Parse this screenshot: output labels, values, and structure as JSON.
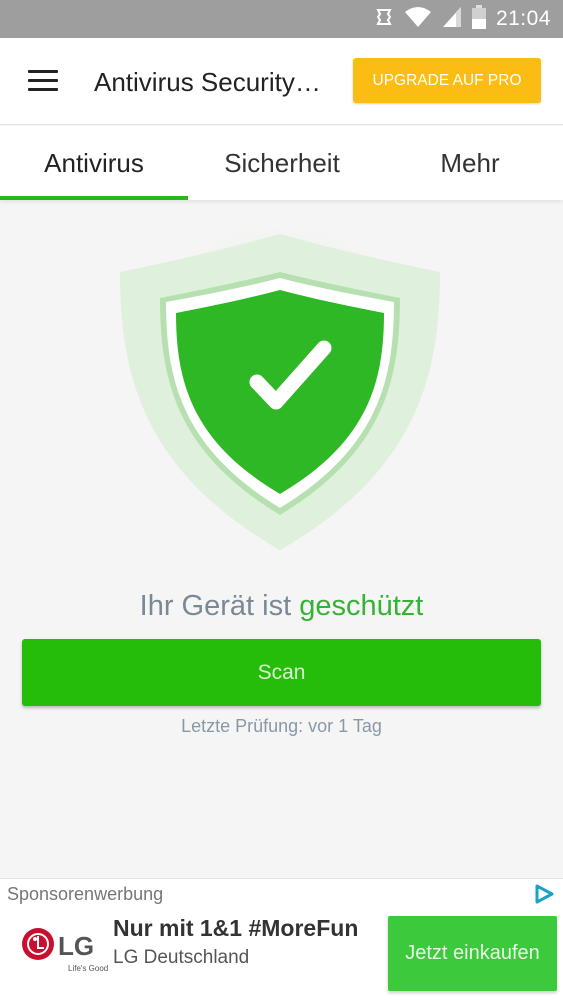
{
  "status_bar": {
    "time": "21:04",
    "icons": [
      "vibrate-icon",
      "wifi-icon",
      "signal-icon",
      "battery-icon"
    ]
  },
  "app_bar": {
    "menu_icon": "hamburger-menu-icon",
    "title": "Antivirus Security…",
    "upgrade_label": "UPGRADE AUF PRO"
  },
  "tabs": [
    {
      "label": "Antivirus",
      "active": true
    },
    {
      "label": "Sicherheit",
      "active": false
    },
    {
      "label": "Mehr",
      "active": false
    }
  ],
  "main": {
    "shield_icon": "shield-check-icon",
    "status_prefix": "Ihr Gerät ist",
    "status_value": "geschützt",
    "scan_label": "Scan",
    "last_scan": "Letzte Prüfung: vor 1 Tag"
  },
  "ad": {
    "label": "Sponsorenwerbung",
    "brand": "LG",
    "brand_tagline": "Life's Good",
    "headline": "Nur mit 1&1 #MoreFun",
    "advertiser": "LG Deutschland",
    "cta": "Jetzt einkaufen"
  },
  "colors": {
    "accent_green": "#25bc0a",
    "upgrade_yellow": "#fbbc13",
    "status_green": "#36b334"
  }
}
